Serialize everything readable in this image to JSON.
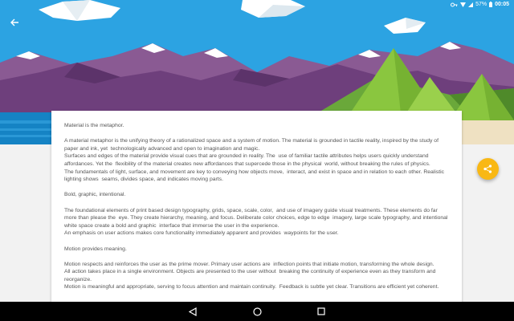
{
  "status_bar": {
    "battery": "57%",
    "time": "00:05",
    "icons": [
      "key-icon",
      "wifi-icon",
      "signal-icon",
      "battery-icon"
    ]
  },
  "toolbar": {
    "back_icon": "arrow-back-icon"
  },
  "article": {
    "paragraphs": [
      "Material is the metaphor.",
      "A material metaphor is the unifying theory of a rationalized space and a system of motion. The material is grounded in tactile reality, inspired by the study of paper and ink, yet  technologically advanced and open to imagination and magic.",
      "Surfaces and edges of the material provide visual cues that are grounded in reality. The  use of familiar tactile attributes helps users quickly understand affordances. Yet the  flexibility of the material creates new affordances that supercede those in the physical  world, without breaking the rules of physics.",
      "The fundamentals of light, surface, and movement are key to conveying how objects move,  interact, and exist in space and in relation to each other. Realistic lighting shows  seams, divides space, and indicates moving parts.",
      "Bold, graphic, intentional.",
      "The foundational elements of print based design typography, grids, space, scale, color,  and use of imagery guide visual treatments. These elements do far more than please the  eye. They create hierarchy, meaning, and focus. Deliberate color choices, edge to edge  imagery, large scale typography, and intentional white space create a bold and graphic  interface that immerse the user in the experience.",
      "An emphasis on user actions makes core functionality immediately apparent and provides  waypoints for the user.",
      "Motion provides meaning.",
      "Motion respects and reinforces the user as the prime mover. Primary user actions are  inflection points that initiate motion, transforming the whole design.",
      "All action takes place in a single environment. Objects are presented to the user without  breaking the continuity of experience even as they transform and reorganize.",
      "Motion is meaningful and appropriate, serving to focus attention and maintain continuity.  Feedback is subtle yet clear. Transitions are efficient yet coherent."
    ]
  },
  "fab": {
    "icon": "share-icon",
    "color": "#f9b814"
  },
  "nav_bar": {
    "buttons": [
      "back-triangle-icon",
      "home-circle-icon",
      "recents-square-icon"
    ]
  },
  "colors": {
    "sky": "#2aa0e0",
    "mountains": "#7b4a86",
    "grass": "#6aa83a",
    "tree": "#8ac63f",
    "water": "#1583c4",
    "fab": "#f9b814"
  }
}
